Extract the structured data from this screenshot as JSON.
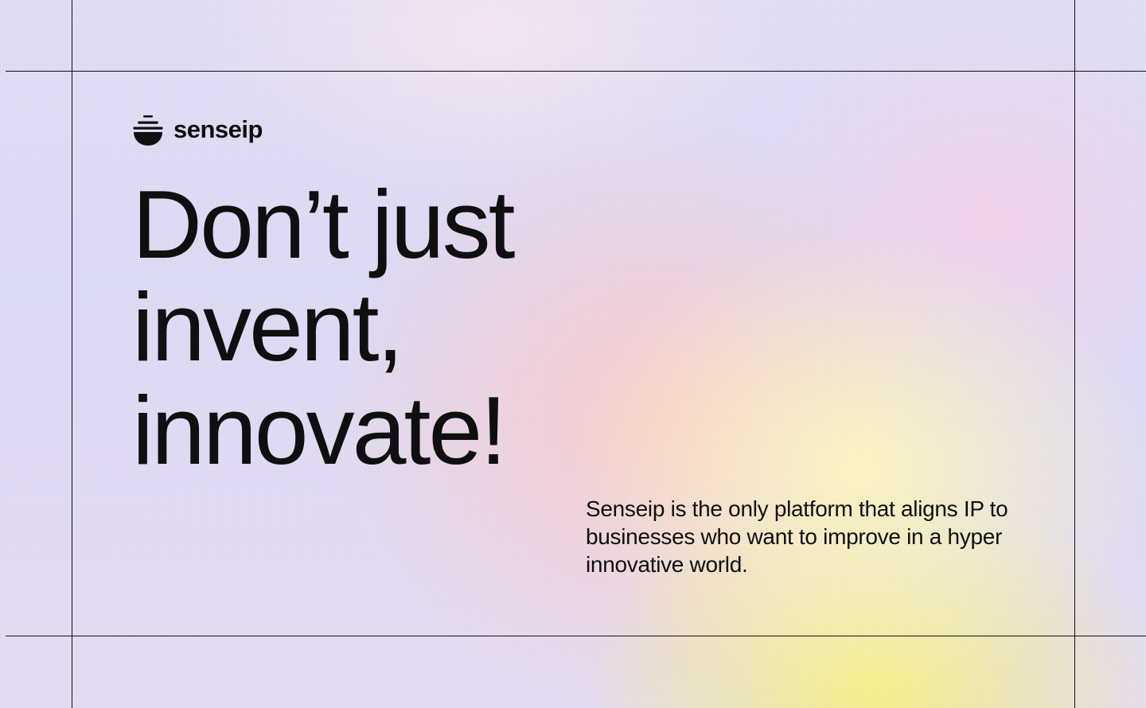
{
  "brand": {
    "name": "senseip",
    "logo_icon": "stacked-bowl-icon",
    "text_color": "#0f0f10"
  },
  "hero": {
    "headline_lines": [
      "Don’t just",
      "invent,",
      "innovate!"
    ],
    "tagline": "Senseip is the only platform that aligns IP to businesses who want to improve in a hyper innovative world."
  },
  "colors": {
    "background_lavender": "#dcdaf3",
    "gradient_pink": "#facdcd",
    "gradient_yellow": "#f6f182",
    "guide_lines": "#111111"
  }
}
